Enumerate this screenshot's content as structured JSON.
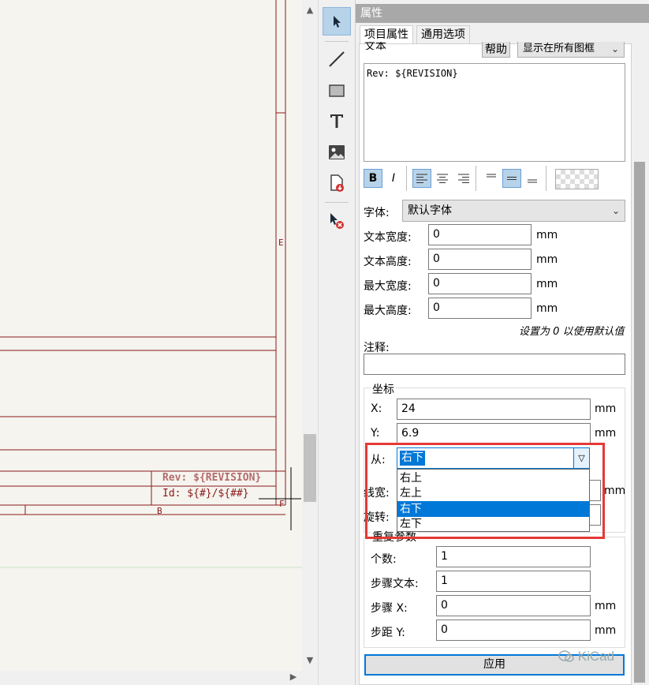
{
  "canvas": {
    "zone_e": "E",
    "zone_f": "F",
    "zone_b": "B",
    "titleblock_rev": "Rev: ${REVISION}",
    "titleblock_id": "Id: ${#}/${##}"
  },
  "panel": {
    "title": "属性",
    "tabs": [
      "项目属性",
      "通用选项"
    ],
    "text_label": "文本",
    "help_button": "帮助",
    "visibility_combo": "显示在所有图框",
    "text_value": "Rev: ${REVISION}",
    "format": {
      "bold": "B",
      "italic": "I"
    },
    "font_label": "字体:",
    "font_value": "默认字体",
    "text_width_label": "文本宽度:",
    "text_width_value": "0",
    "text_height_label": "文本高度:",
    "text_height_value": "0",
    "max_width_label": "最大宽度:",
    "max_width_value": "0",
    "max_height_label": "最大高度:",
    "max_height_value": "0",
    "unit": "mm",
    "hint": "设置为 0 以使用默认值",
    "comment_label": "注释:",
    "comment_value": "",
    "coords_group": "坐标",
    "x_label": "X:",
    "x_value": "24",
    "y_label": "Y:",
    "y_value": "6.9",
    "from_label": "从:",
    "from_selected": "右下",
    "from_options": [
      "右上",
      "左上",
      "右下",
      "左下"
    ],
    "line_width_label": "线宽:",
    "rotation_label": "旋转:",
    "repeat_group": "重复参数",
    "count_label": "个数:",
    "count_value": "1",
    "step_text_label": "步骤文本:",
    "step_text_value": "1",
    "step_x_label": "步骤 X:",
    "step_x_value": "0",
    "step_y_label": "步距 Y:",
    "step_y_value": "0",
    "apply_button": "应用",
    "watermark": "KiCad"
  }
}
